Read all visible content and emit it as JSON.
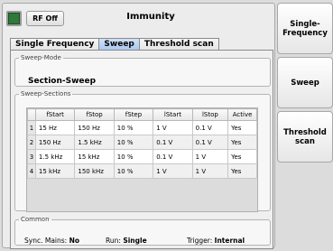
{
  "header": {
    "rf_button": "RF Off",
    "title": "Immunity"
  },
  "tabs": [
    {
      "label": "Single Frequency",
      "active": false
    },
    {
      "label": "Sweep",
      "active": true
    },
    {
      "label": "Threshold scan",
      "active": false
    }
  ],
  "sweep_mode": {
    "legend": "Sweep-Mode",
    "value": "Section-Sweep"
  },
  "sweep_sections": {
    "legend": "Sweep-Sections",
    "columns": [
      "fStart",
      "fStop",
      "fStep",
      "lStart",
      "lStop",
      "Active"
    ],
    "rows": [
      {
        "num": "1",
        "cells": [
          "15 Hz",
          "150 Hz",
          "10 %",
          "1 V",
          "0.1 V",
          "Yes"
        ]
      },
      {
        "num": "2",
        "cells": [
          "150 Hz",
          "1.5 kHz",
          "10 %",
          "0.1 V",
          "0.1 V",
          "Yes"
        ]
      },
      {
        "num": "3",
        "cells": [
          "1.5 kHz",
          "15 kHz",
          "10 %",
          "0.1 V",
          "1 V",
          "Yes"
        ]
      },
      {
        "num": "4",
        "cells": [
          "15 kHz",
          "150 kHz",
          "10 %",
          "1 V",
          "1 V",
          "Yes"
        ]
      }
    ]
  },
  "common": {
    "legend": "Common",
    "sync_label": "Sync. Mains:",
    "sync_value": "No",
    "run_label": "Run:",
    "run_value": "Single",
    "trigger_label": "Trigger:",
    "trigger_value": "Internal"
  },
  "side_buttons": [
    {
      "label": "Single-\nFrequency"
    },
    {
      "label": "Sweep"
    },
    {
      "label": "Threshold\nscan"
    }
  ],
  "colors": {
    "indicator": "#2f7a3a",
    "active_tab": "#a9c6ee"
  }
}
